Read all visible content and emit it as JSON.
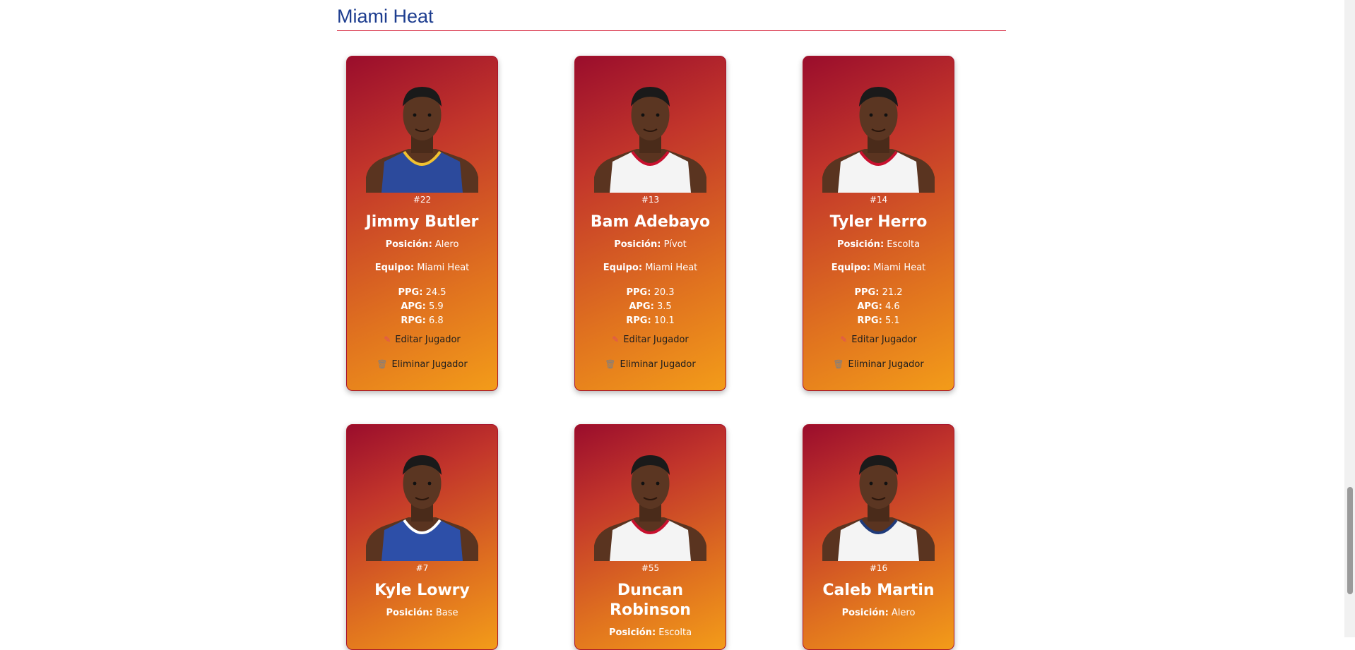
{
  "team": {
    "name": "Miami Heat"
  },
  "labels": {
    "position": "Posición:",
    "team": "Equipo:",
    "ppg": "PPG:",
    "apg": "APG:",
    "rpg": "RPG:",
    "edit": "Editar Jugador",
    "delete": "Eliminar Jugador"
  },
  "icons": {
    "edit": "pencil-icon",
    "delete": "trash-icon"
  },
  "colors": {
    "title": "#1d3d8f",
    "divider": "#d6253d",
    "card_top": "#9a0d2c",
    "card_bottom": "#f39c19"
  },
  "players": [
    {
      "number": "#22",
      "name": "Jimmy Butler",
      "position": "Alero",
      "team": "Miami Heat",
      "ppg": "24.5",
      "apg": "5.9",
      "rpg": "6.8",
      "jersey": "blue"
    },
    {
      "number": "#13",
      "name": "Bam Adebayo",
      "position": "Pívot",
      "team": "Miami Heat",
      "ppg": "20.3",
      "apg": "3.5",
      "rpg": "10.1",
      "jersey": "white"
    },
    {
      "number": "#14",
      "name": "Tyler Herro",
      "position": "Escolta",
      "team": "Miami Heat",
      "ppg": "21.2",
      "apg": "4.6",
      "rpg": "5.1",
      "jersey": "white"
    },
    {
      "number": "#7",
      "name": "Kyle Lowry",
      "position": "Base",
      "jersey": "royal"
    },
    {
      "number": "#55",
      "name": "Duncan Robinson",
      "position": "Escolta",
      "jersey": "white"
    },
    {
      "number": "#16",
      "name": "Caleb Martin",
      "position": "Alero",
      "jersey": "white-navy"
    }
  ]
}
